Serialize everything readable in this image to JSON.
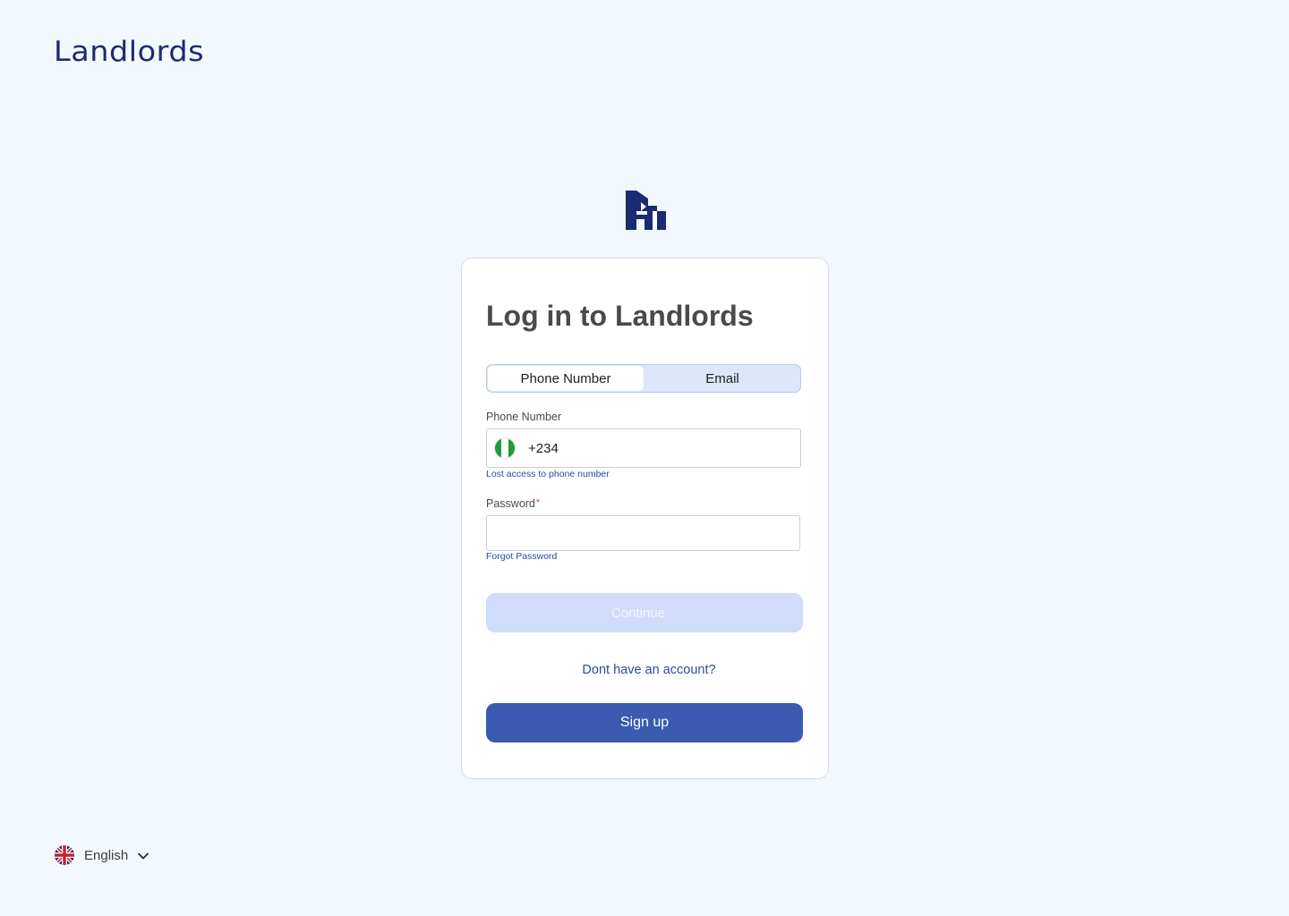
{
  "brand": {
    "name": "Landlords"
  },
  "login": {
    "title": "Log in to Landlords",
    "tabs": [
      {
        "label": "Phone Number",
        "active": true
      },
      {
        "label": "Email",
        "active": false
      }
    ],
    "phone": {
      "label": "Phone Number",
      "country_flag": "nigeria-flag-icon",
      "dial_code": "+234",
      "value": "",
      "lost_access_link": "Lost access to phone number"
    },
    "password": {
      "label": "Password",
      "required_mark": "*",
      "value": "",
      "forgot_link": "Forgot Password"
    },
    "continue_label": "Continue",
    "no_account_text": "Dont have an account?",
    "signup_label": "Sign up"
  },
  "language": {
    "flag": "uk-flag-icon",
    "selected": "English"
  },
  "colors": {
    "background": "#f3f8fd",
    "brand": "#1a2a73",
    "primary": "#3a5bb0",
    "primary_disabled": "#cfdcfa",
    "link": "#2b4aa0"
  }
}
